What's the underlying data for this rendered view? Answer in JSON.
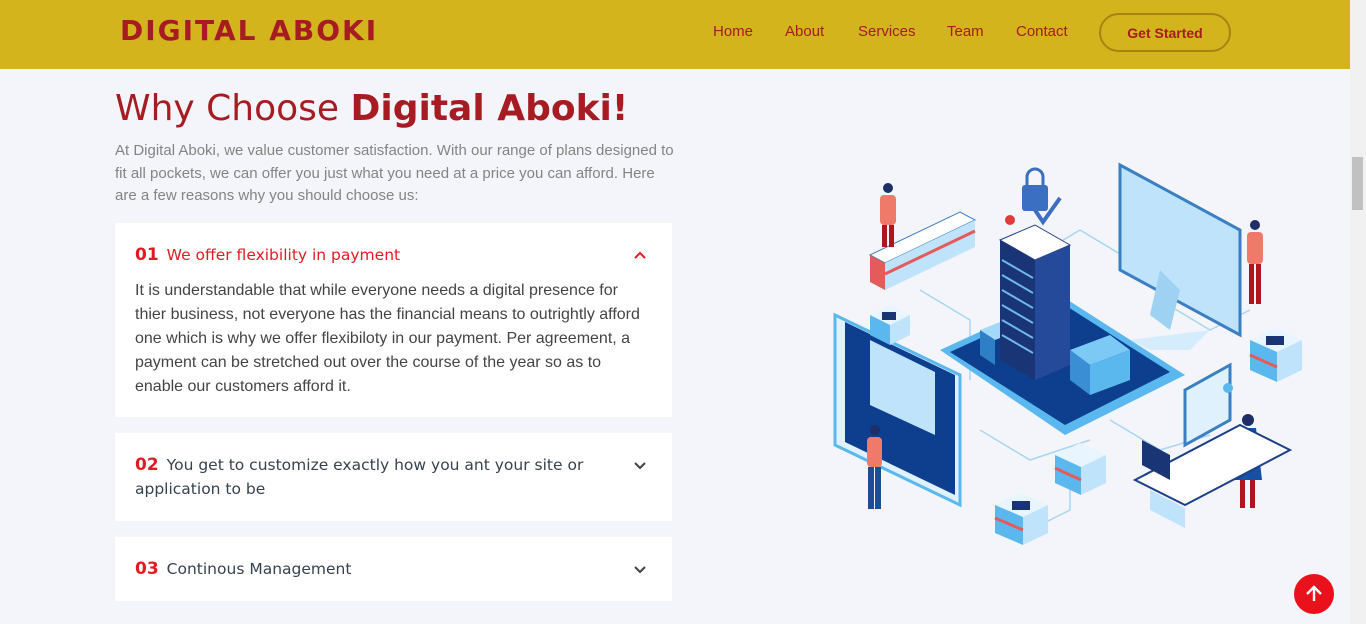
{
  "header": {
    "logo": "DIGITAL ABOKI",
    "nav": [
      "Home",
      "About",
      "Services",
      "Team",
      "Contact"
    ],
    "cta_label": "Get Started"
  },
  "section": {
    "title_regular": "Why Choose ",
    "title_bold": "Digital Aboki!",
    "intro": "At Digital Aboki, we value customer satisfaction. With our range of plans designed to fit all pockets, we can offer you just what you need at a price you can afford. Here are a few reasons why you should choose us:"
  },
  "faq": [
    {
      "number": "01",
      "question": "We offer flexibility in payment",
      "answer": "It is understandable that while everyone needs a digital presence for thier business, not everyone has the financial means to outrightly afford one which is why we offer flexibiloty in our payment. Per agreement, a payment can be stretched out over the course of the year so as to enable our customers afford it.",
      "expanded": true
    },
    {
      "number": "02",
      "question": "You get to customize exactly how you ant your site or application to be",
      "expanded": false
    },
    {
      "number": "03",
      "question": "Continous Management",
      "expanded": false
    }
  ],
  "colors": {
    "header_bg": "#d3b41c",
    "brand_red": "#a61c22",
    "accent_red": "#e11b22",
    "page_bg": "#f3f5fa"
  },
  "icons": {
    "expanded": "chevron-up-icon",
    "collapsed": "chevron-down-icon",
    "back_to_top": "arrow-up-icon"
  }
}
